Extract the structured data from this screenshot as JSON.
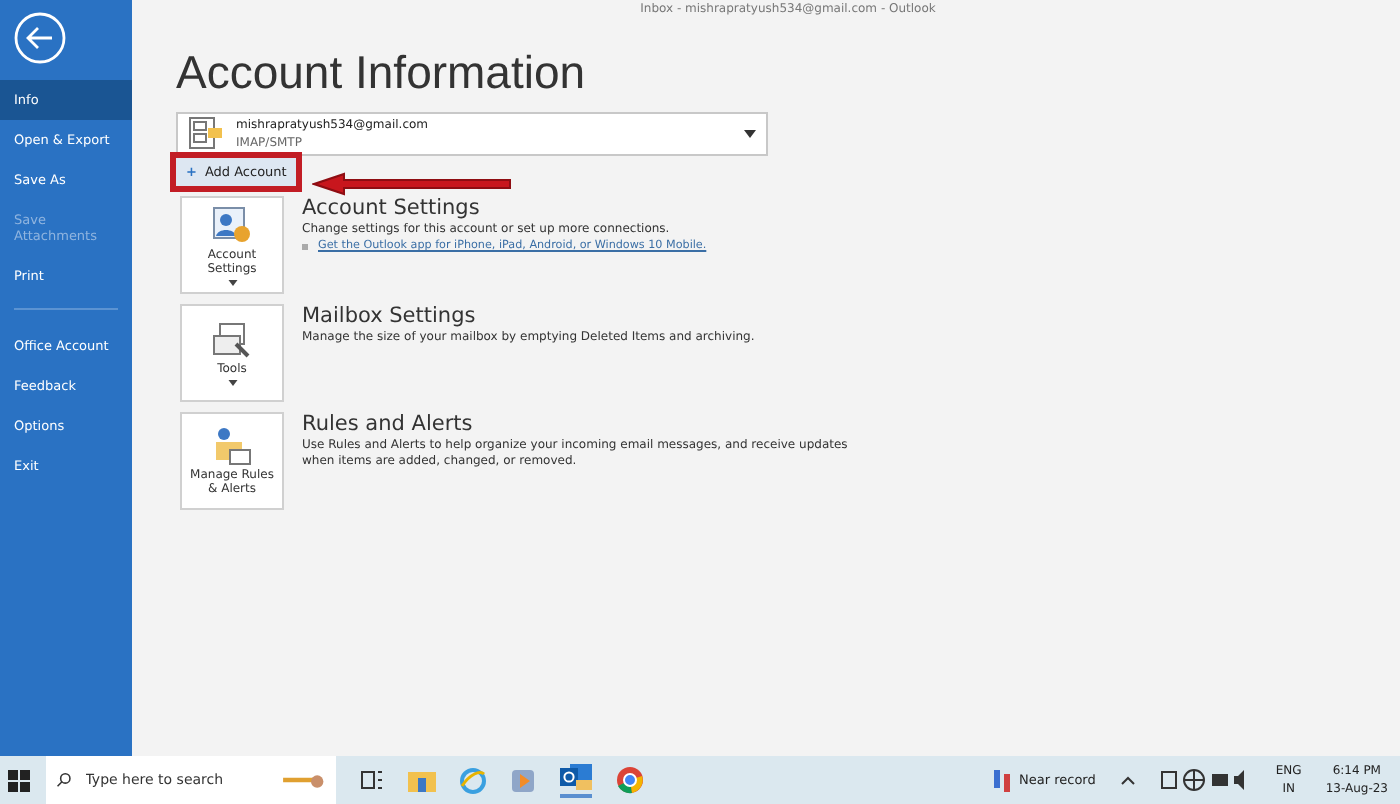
{
  "window": {
    "title": "Inbox - mishrapratyush534@gmail.com - Outlook"
  },
  "sidebar": {
    "items": [
      {
        "label": "Info",
        "selected": true,
        "disabled": false
      },
      {
        "label": "Open & Export",
        "selected": false,
        "disabled": false
      },
      {
        "label": "Save As",
        "selected": false,
        "disabled": false
      },
      {
        "label": "Save Attachments",
        "selected": false,
        "disabled": true
      },
      {
        "label": "Print",
        "selected": false,
        "disabled": false
      },
      {
        "label": "Office Account",
        "selected": false,
        "disabled": false
      },
      {
        "label": "Feedback",
        "selected": false,
        "disabled": false
      },
      {
        "label": "Options",
        "selected": false,
        "disabled": false
      },
      {
        "label": "Exit",
        "selected": false,
        "disabled": false
      }
    ]
  },
  "heading": "Account Information",
  "account": {
    "email": "mishrapratyush534@gmail.com",
    "type": "IMAP/SMTP"
  },
  "add_account": {
    "icon": "+",
    "label": "Add Account",
    "highlighted": true
  },
  "sections": [
    {
      "kind": "account",
      "button": "Account Settings",
      "button_caret": true,
      "title": "Account Settings",
      "description": "Change settings for this account or set up more connections.",
      "link": "Get the Outlook app for iPhone, iPad, Android, or Windows 10 Mobile."
    },
    {
      "kind": "tools",
      "button": "Tools",
      "button_caret": true,
      "title": "Mailbox Settings",
      "description": "Manage the size of your mailbox by emptying Deleted Items and archiving."
    },
    {
      "kind": "rules",
      "button": "Manage Rules & Alerts",
      "button_caret": false,
      "title": "Rules and Alerts",
      "description": "Use Rules and Alerts to help organize your incoming email messages, and receive updates when items are added, changed, or removed."
    }
  ],
  "taskbar": {
    "search_placeholder": "Type here to search",
    "weather": "Near record",
    "language": "ENG",
    "region": "IN",
    "time": "6:14 PM",
    "date": "13-Aug-23"
  }
}
